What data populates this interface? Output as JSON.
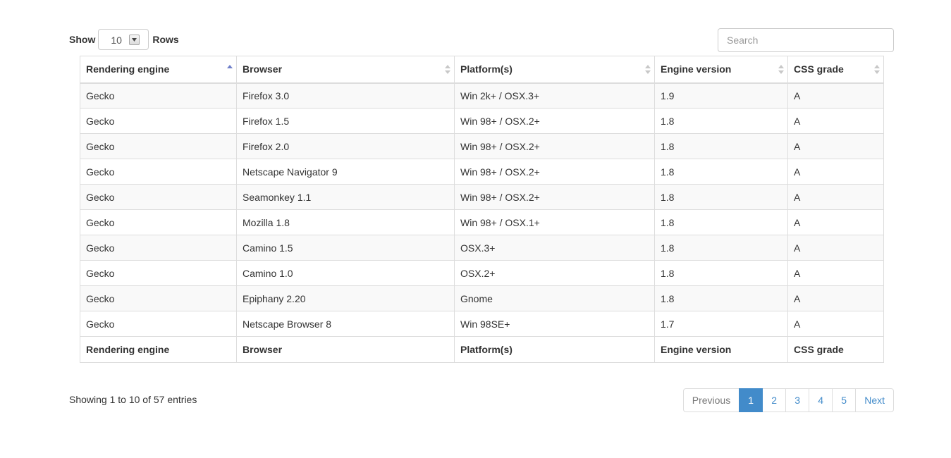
{
  "length_control": {
    "show_label": "Show",
    "selected": "10",
    "rows_label": "Rows"
  },
  "search": {
    "placeholder": "Search",
    "value": ""
  },
  "table": {
    "columns": [
      {
        "label": "Rendering engine",
        "sort": "asc"
      },
      {
        "label": "Browser",
        "sort": "none"
      },
      {
        "label": "Platform(s)",
        "sort": "none"
      },
      {
        "label": "Engine version",
        "sort": "none"
      },
      {
        "label": "CSS grade",
        "sort": "none"
      }
    ],
    "rows": [
      [
        "Gecko",
        "Firefox 3.0",
        "Win 2k+ / OSX.3+",
        "1.9",
        "A"
      ],
      [
        "Gecko",
        "Firefox 1.5",
        "Win 98+ / OSX.2+",
        "1.8",
        "A"
      ],
      [
        "Gecko",
        "Firefox 2.0",
        "Win 98+ / OSX.2+",
        "1.8",
        "A"
      ],
      [
        "Gecko",
        "Netscape Navigator 9",
        "Win 98+ / OSX.2+",
        "1.8",
        "A"
      ],
      [
        "Gecko",
        "Seamonkey 1.1",
        "Win 98+ / OSX.2+",
        "1.8",
        "A"
      ],
      [
        "Gecko",
        "Mozilla 1.8",
        "Win 98+ / OSX.1+",
        "1.8",
        "A"
      ],
      [
        "Gecko",
        "Camino 1.5",
        "OSX.3+",
        "1.8",
        "A"
      ],
      [
        "Gecko",
        "Camino 1.0",
        "OSX.2+",
        "1.8",
        "A"
      ],
      [
        "Gecko",
        "Epiphany 2.20",
        "Gnome",
        "1.8",
        "A"
      ],
      [
        "Gecko",
        "Netscape Browser 8",
        "Win 98SE+",
        "1.7",
        "A"
      ]
    ],
    "footer": [
      "Rendering engine",
      "Browser",
      "Platform(s)",
      "Engine version",
      "CSS grade"
    ]
  },
  "info": "Showing 1 to 10 of 57 entries",
  "pagination": {
    "previous": "Previous",
    "pages": [
      "1",
      "2",
      "3",
      "4",
      "5"
    ],
    "active_page": "1",
    "next": "Next"
  },
  "colors": {
    "accent": "#428bca",
    "sort_active": "#6f7fc9",
    "sort_inactive": "#c8c8c8",
    "border": "#dddddd",
    "stripe": "#f9f9f9"
  }
}
